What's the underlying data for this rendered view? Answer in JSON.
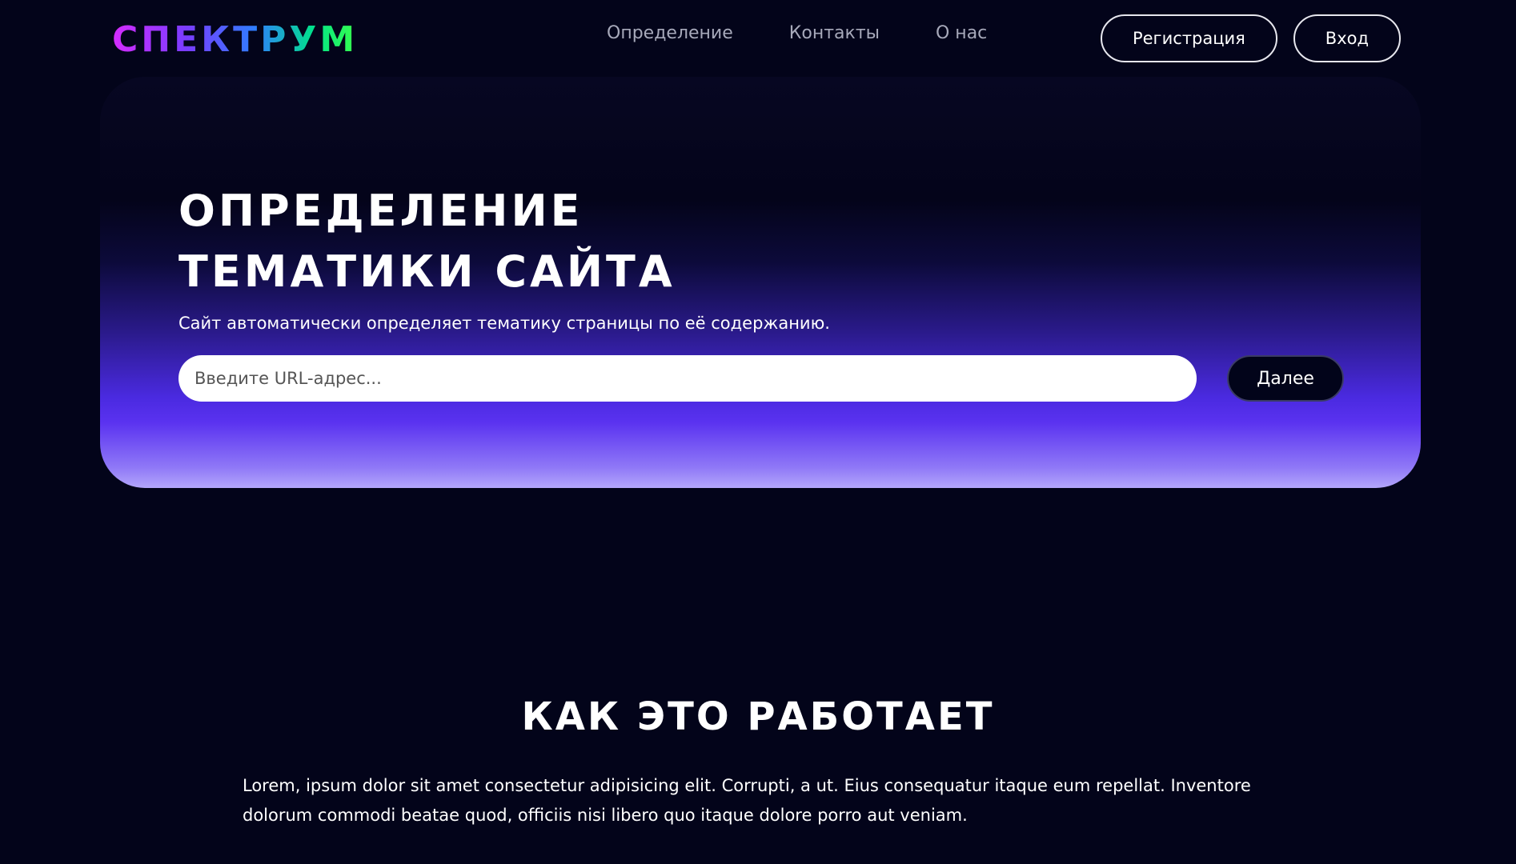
{
  "header": {
    "logo": "СПЕКТРУМ",
    "nav": [
      "Определение",
      "Контакты",
      "О нас"
    ],
    "register_label": "Регистрация",
    "login_label": "Вход"
  },
  "hero": {
    "title_line1": "ОПРЕДЕЛЕНИЕ",
    "title_line2": "ТЕМАТИКИ САЙТА",
    "subtitle": "Сайт автоматически определяет тематику страницы по её содержанию.",
    "input_placeholder": "Введите URL-адрес...",
    "next_label": "Далее"
  },
  "how": {
    "title": "КАК ЭТО РАБОТАЕТ",
    "text": "Lorem, ipsum dolor sit amet consectetur adipisicing elit. Corrupti, a ut. Eius consequatur itaque eum repellat. Inventore dolorum commodi beatae quod, officiis nisi libero quo itaque dolore porro aut veniam."
  },
  "colors": {
    "background": "#03041a",
    "accent": "#5a32f0",
    "nav_text": "#a7a9ba"
  }
}
